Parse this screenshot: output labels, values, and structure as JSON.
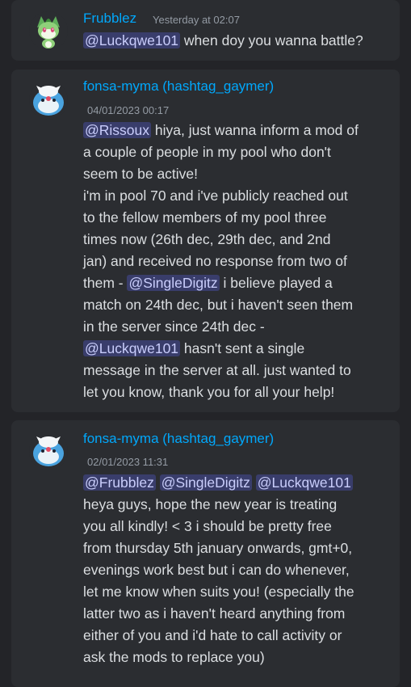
{
  "messages": [
    {
      "author": "Frubblez",
      "timestamp": "Yesterday at 02:07",
      "avatar": "sprigatito-avatar",
      "lines": [
        {
          "mention": "@Luckqwe101",
          "text": " when doy you wanna battle?"
        }
      ]
    },
    {
      "author": "fonsa-myma (hashtag_gaymer)",
      "timestamp": "04/01/2023 00:17",
      "avatar": "spheal-avatar",
      "lines": [
        {
          "mention": "@Rissoux",
          "text": " hiya, just wanna inform a mod of"
        },
        {
          "text": "a couple of people in my pool who don't"
        },
        {
          "text": "seem to be active!"
        },
        {
          "text": "i'm in pool 70 and i've publicly reached out"
        },
        {
          "text": "to the fellow members of my pool three"
        },
        {
          "text": "times now (26th dec, 29th dec, and 2nd"
        },
        {
          "text": "jan) and received no response from two of"
        },
        {
          "pre": "them - ",
          "mention": "@SingleDigitz",
          "text": " i believe played a"
        },
        {
          "text": "match on 24th dec, but i haven't seen them"
        },
        {
          "text": "in the server since 24th dec -"
        },
        {
          "mention": "@Luckqwe101",
          "text": " hasn't sent a single"
        },
        {
          "text": "message in the server at all. just wanted to"
        },
        {
          "text": "let you know, thank you for all your help!"
        }
      ]
    },
    {
      "author": "fonsa-myma (hashtag_gaymer)",
      "timestamp": "02/01/2023 11:31",
      "avatar": "spheal-avatar",
      "lines": [
        {
          "mention": "@Frubblez",
          "mention2": "@SingleDigitz",
          "mention3": "@Luckqwe101"
        },
        {
          "text": "heya guys, hope the new year is treating"
        },
        {
          "text": "you all kindly! < 3 i should be pretty free"
        },
        {
          "text": "from thursday 5th january onwards, gmt+0,"
        },
        {
          "text": "evenings work best but i can do whenever,"
        },
        {
          "text": "let me know when suits you! (especially the"
        },
        {
          "text": "latter two as i haven't heard anything from"
        },
        {
          "text": "either of you and i'd hate to call activity or"
        },
        {
          "text": "ask the mods to replace you)"
        }
      ]
    }
  ],
  "colors": {
    "background": "#232428",
    "card": "#2b2d31",
    "username": "#00a8fc",
    "mention_bg": "#454b82",
    "text": "#dbdee1",
    "timestamp": "#949ba4"
  }
}
